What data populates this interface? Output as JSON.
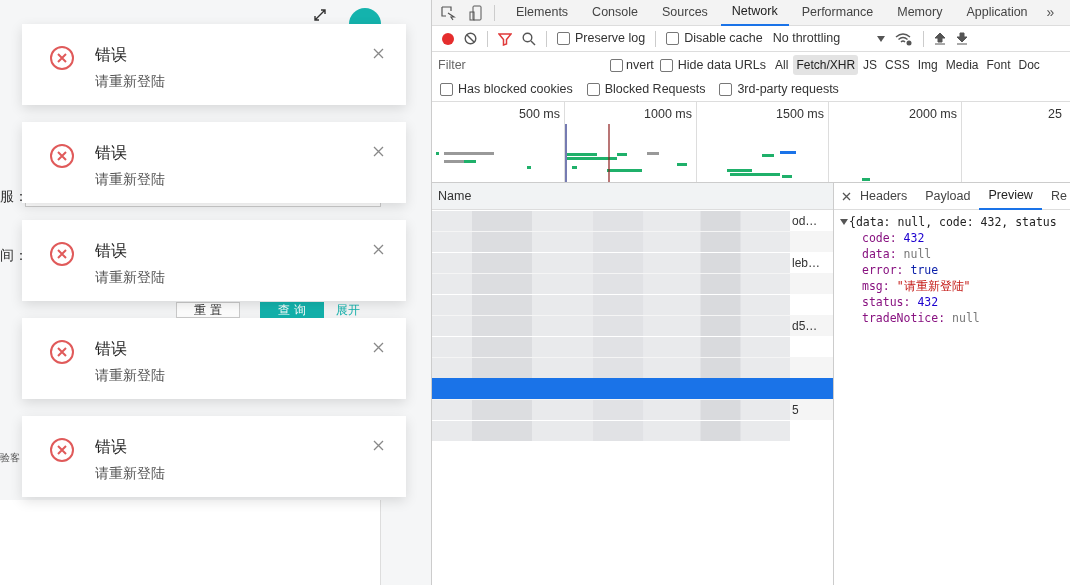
{
  "app": {
    "form_labels": [
      "服：",
      "间："
    ],
    "reset_button": "重 置",
    "search_button": "查 询",
    "expand_link": "展开",
    "table_fragment": "验客"
  },
  "notifications": [
    {
      "title": "错误",
      "message": "请重新登陆"
    },
    {
      "title": "错误",
      "message": "请重新登陆"
    },
    {
      "title": "错误",
      "message": "请重新登陆"
    },
    {
      "title": "错误",
      "message": "请重新登陆"
    },
    {
      "title": "错误",
      "message": "请重新登陆"
    }
  ],
  "devtools": {
    "tabs": [
      {
        "label": "Elements",
        "selected": false
      },
      {
        "label": "Console",
        "selected": false
      },
      {
        "label": "Sources",
        "selected": false
      },
      {
        "label": "Network",
        "selected": true
      },
      {
        "label": "Performance",
        "selected": false
      },
      {
        "label": "Memory",
        "selected": false
      },
      {
        "label": "Application",
        "selected": false
      }
    ],
    "more_tabs": "»",
    "toolbar": {
      "recording": true,
      "preserve_log": {
        "label": "Preserve log",
        "checked": false
      },
      "disable_cache": {
        "label": "Disable cache",
        "checked": false
      },
      "throttling": "No throttling"
    },
    "filter": {
      "placeholder": "Filter",
      "invert": {
        "label": "nvert",
        "checked": false
      },
      "hide_data_urls": {
        "label": "Hide data URLs",
        "checked": false
      },
      "types": [
        {
          "label": "All",
          "selected": false
        },
        {
          "label": "Fetch/XHR",
          "selected": true
        },
        {
          "label": "JS",
          "selected": false
        },
        {
          "label": "CSS",
          "selected": false
        },
        {
          "label": "Img",
          "selected": false
        },
        {
          "label": "Media",
          "selected": false
        },
        {
          "label": "Font",
          "selected": false
        },
        {
          "label": "Doc",
          "selected": false
        }
      ]
    },
    "filter_options": [
      {
        "label": "Has blocked cookies",
        "checked": false
      },
      {
        "label": "Blocked Requests",
        "checked": false
      },
      {
        "label": "3rd-party requests",
        "checked": false
      }
    ],
    "timeline_ticks": [
      "500 ms",
      "1000 ms",
      "1500 ms",
      "2000 ms",
      "25"
    ],
    "requests": {
      "column": "Name",
      "rows": [
        {
          "tail": "od…",
          "selected": false
        },
        {
          "selected": false
        },
        {
          "tail": "leb…",
          "selected": false
        },
        {
          "selected": false
        },
        {
          "selected": false
        },
        {
          "tail": "d5…",
          "selected": false
        },
        {
          "selected": false
        },
        {
          "selected": false
        },
        {
          "selected": true
        },
        {
          "tail": "5",
          "selected": false
        },
        {
          "selected": false
        }
      ]
    },
    "detail_tabs": [
      {
        "label": "Headers",
        "selected": false
      },
      {
        "label": "Payload",
        "selected": false
      },
      {
        "label": "Preview",
        "selected": true
      },
      {
        "label": "Re",
        "selected": false
      }
    ],
    "preview": {
      "summary": "{data: null, code: 432, status",
      "fields": [
        {
          "key": "code:",
          "value": "432",
          "kind": "number"
        },
        {
          "key": "data:",
          "value": "null",
          "kind": "null"
        },
        {
          "key": "error:",
          "value": "true",
          "kind": "bool"
        },
        {
          "key": "msg:",
          "value": "\"请重新登陆\"",
          "kind": "string"
        },
        {
          "key": "status:",
          "value": "432",
          "kind": "number"
        },
        {
          "key": "tradeNotice:",
          "value": "null",
          "kind": "null"
        }
      ]
    }
  }
}
